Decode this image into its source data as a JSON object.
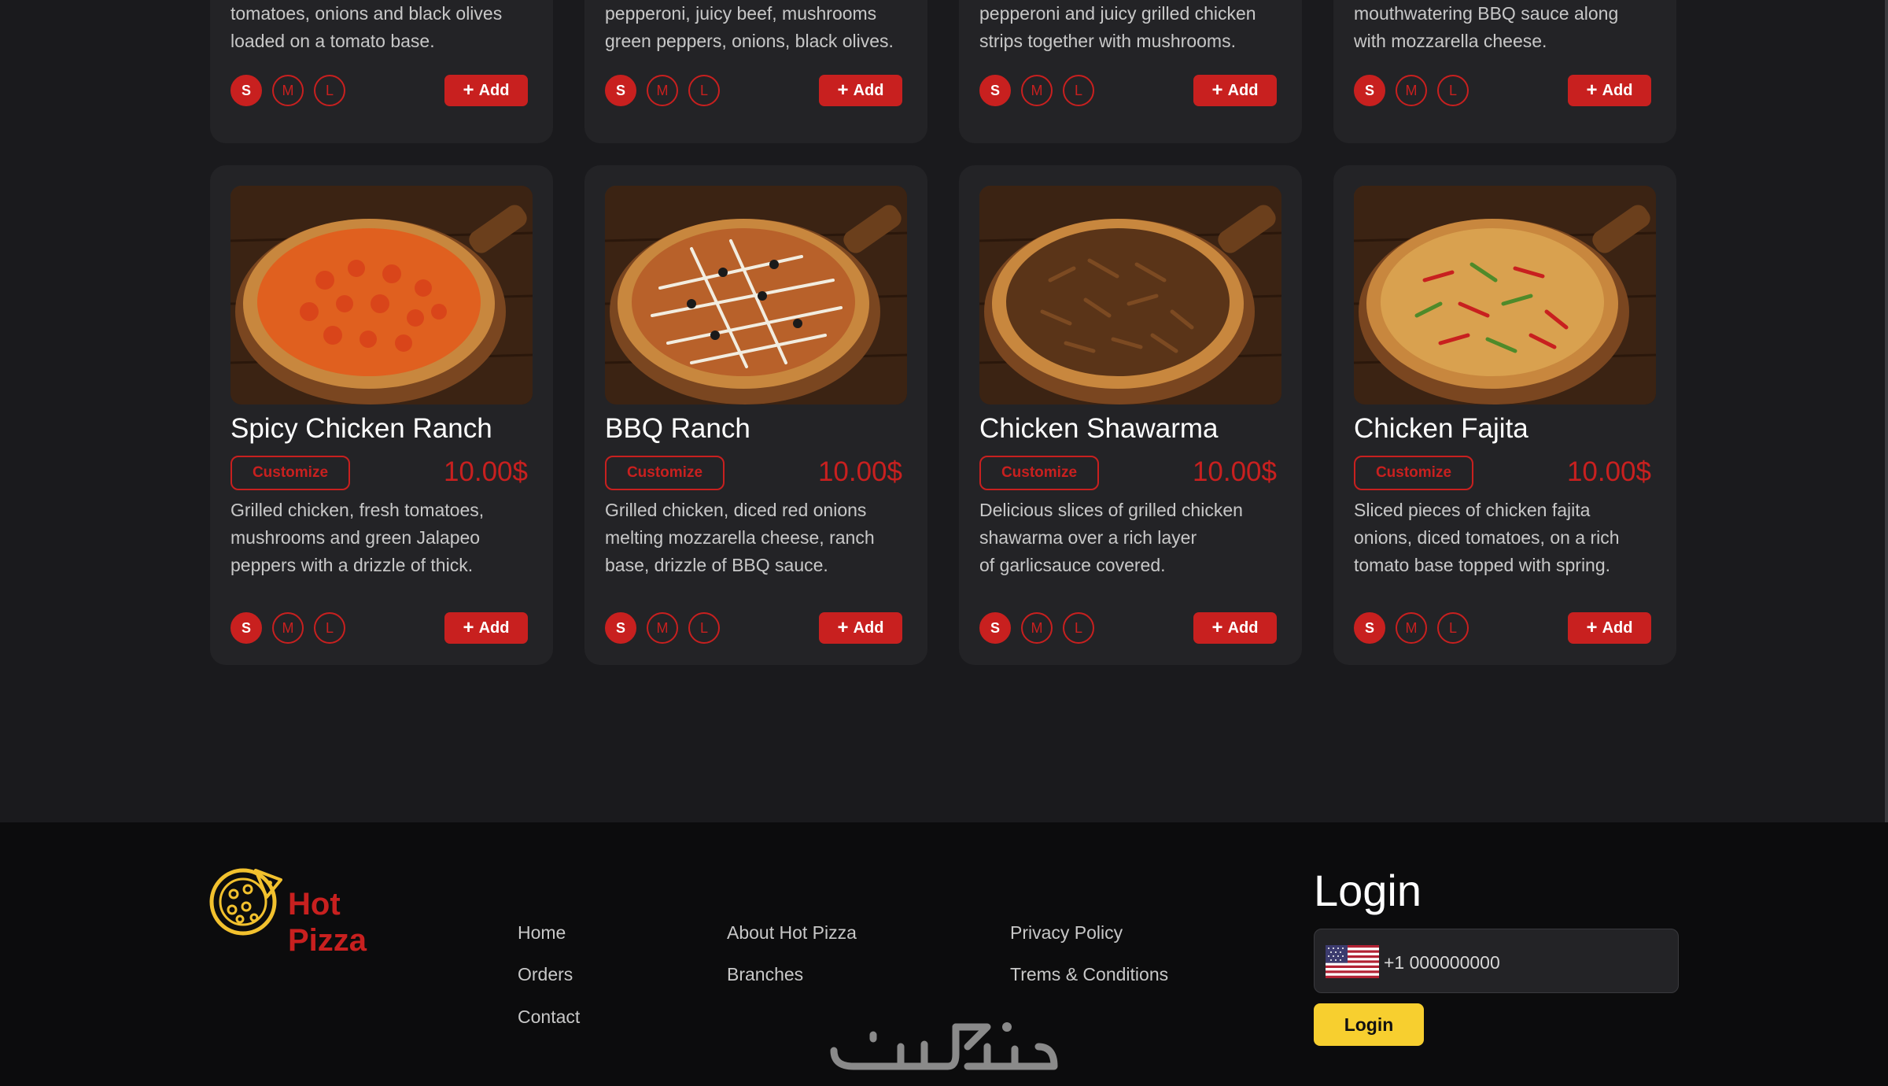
{
  "top_row": [
    {
      "description": "tomatoes, onions and black olives\nloaded on a tomato base.",
      "sizes": [
        "S",
        "M",
        "L"
      ],
      "add_label": "Add"
    },
    {
      "description": "pepperoni, juicy beef, mushrooms\ngreen peppers, onions, black olives.",
      "sizes": [
        "S",
        "M",
        "L"
      ],
      "add_label": "Add"
    },
    {
      "description": "pepperoni and juicy grilled chicken\nstrips together with mushrooms.",
      "sizes": [
        "S",
        "M",
        "L"
      ],
      "add_label": "Add"
    },
    {
      "description": "mouthwatering BBQ sauce along\nwith mozzarella cheese.",
      "sizes": [
        "S",
        "M",
        "L"
      ],
      "add_label": "Add"
    }
  ],
  "products": [
    {
      "name": "Spicy Chicken Ranch",
      "customize_label": "Customize",
      "price": "10.00$",
      "description": "Grilled chicken, fresh tomatoes,\nmushrooms and green Jalapeo\npeppers with a drizzle of thick.",
      "sizes": [
        "S",
        "M",
        "L"
      ],
      "add_label": "Add",
      "image_icon": "pizza-spicy-chicken-ranch-image"
    },
    {
      "name": "BBQ Ranch",
      "customize_label": "Customize",
      "price": "10.00$",
      "description": "Grilled chicken, diced red onions\nmelting mozzarella cheese, ranch\nbase, drizzle of BBQ sauce.",
      "sizes": [
        "S",
        "M",
        "L"
      ],
      "add_label": "Add",
      "image_icon": "pizza-bbq-ranch-image"
    },
    {
      "name": "Chicken Shawarma",
      "customize_label": "Customize",
      "price": "10.00$",
      "description": "Delicious slices of grilled chicken\nshawarma over a rich layer\nof garlicsauce  covered.",
      "sizes": [
        "S",
        "M",
        "L"
      ],
      "add_label": "Add",
      "image_icon": "pizza-chicken-shawarma-image"
    },
    {
      "name": "Chicken Fajita",
      "customize_label": "Customize",
      "price": "10.00$",
      "description": "Sliced pieces of chicken fajita\nonions, diced tomatoes, on a rich\ntomato base topped with spring.",
      "sizes": [
        "S",
        "M",
        "L"
      ],
      "add_label": "Add",
      "image_icon": "pizza-chicken-fajita-image"
    }
  ],
  "footer": {
    "brand": {
      "line1": "Hot",
      "line2": "Pizza",
      "icon": "pizza-logo-icon"
    },
    "links_col1": [
      "Home",
      "Orders",
      "Contact"
    ],
    "links_col2": [
      "About Hot Pizza",
      "Branches"
    ],
    "links_col3": [
      "Privacy Policy",
      "Trems & Conditions"
    ],
    "login": {
      "title": "Login",
      "phone_value": "+1 000000000",
      "flag_icon": "us-flag-icon",
      "button_label": "Login"
    },
    "watermark_icon": "khamsat-watermark-logo"
  },
  "colors": {
    "accent_red": "#c8201f",
    "login_yellow": "#f7cf2f",
    "background": "#1a1a1d",
    "card": "#232326",
    "footer": "#0c0c0d"
  }
}
